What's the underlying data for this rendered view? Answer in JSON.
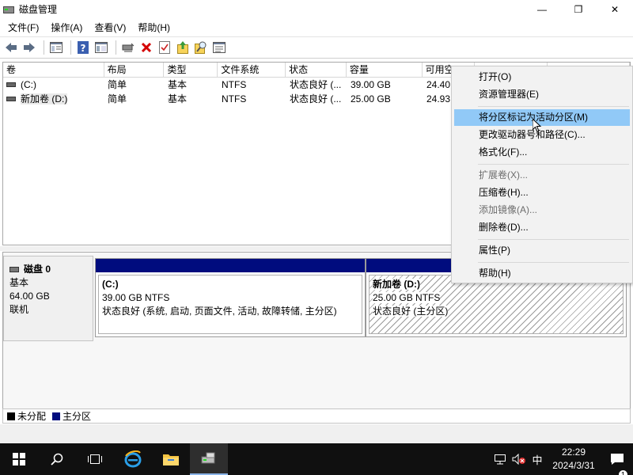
{
  "window": {
    "title": "磁盘管理",
    "minimize_glyph": "—",
    "maximize_glyph": "❐",
    "close_glyph": "✕"
  },
  "menu": [
    "文件(F)",
    "操作(A)",
    "查看(V)",
    "帮助(H)"
  ],
  "toolbar": {
    "icons": [
      "back-icon",
      "forward-icon",
      "console-tree-icon",
      "help-icon",
      "properties-icon",
      "connect-icon",
      "delete-icon",
      "check-icon",
      "upload-icon",
      "search-icon",
      "list-icon"
    ]
  },
  "list": {
    "columns": [
      "卷",
      "布局",
      "类型",
      "文件系统",
      "状态",
      "容量",
      "可用空",
      "",
      ""
    ],
    "rows": [
      {
        "volume": "(C:)",
        "layout": "简单",
        "type": "基本",
        "fs": "NTFS",
        "status": "状态良好 (...",
        "capacity": "39.00 GB",
        "free": "24.40"
      },
      {
        "volume": "新加卷 (D:)",
        "layout": "简单",
        "type": "基本",
        "fs": "NTFS",
        "status": "状态良好 (...",
        "capacity": "25.00 GB",
        "free": "24.93"
      }
    ]
  },
  "disk": {
    "name": "磁盘 0",
    "type": "基本",
    "size": "64.00 GB",
    "state": "联机",
    "partitions": [
      {
        "name": "(C:)",
        "size": "39.00 GB NTFS",
        "status": "状态良好 (系统, 启动, 页面文件, 活动, 故障转储, 主分区)"
      },
      {
        "name": "新加卷 (D:)",
        "size": "25.00 GB NTFS",
        "status": "状态良好 (主分区)"
      }
    ]
  },
  "legend": {
    "unallocated": "未分配",
    "primary": "主分区",
    "unallocated_color": "#000000",
    "primary_color": "#000c7e"
  },
  "context_menu": {
    "items": [
      "打开(O)",
      "资源管理器(E)",
      "将分区标记为活动分区(M)",
      "更改驱动器号和路径(C)...",
      "格式化(F)...",
      "扩展卷(X)...",
      "压缩卷(H)...",
      "添加镜像(A)...",
      "删除卷(D)...",
      "属性(P)",
      "帮助(H)"
    ],
    "highlighted": "将分区标记为活动分区(M)",
    "disabled": [
      "扩展卷(X)...",
      "添加镜像(A)..."
    ],
    "highlight_color": "#91c9f7"
  },
  "taskbar": {
    "ime": "中",
    "time": "22:29",
    "date": "2024/3/31",
    "notification_count": "1"
  }
}
